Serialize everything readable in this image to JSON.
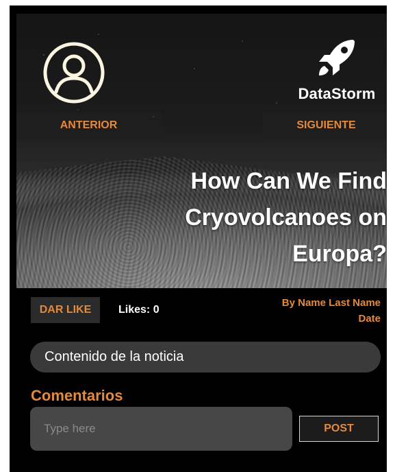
{
  "header": {
    "brand_name": "DataStorm",
    "prev_label": "ANTERIOR",
    "next_label": "SIGUIENTE"
  },
  "article": {
    "title_line1": "How Can We Find",
    "title_line2": "Cryovolcanoes on",
    "title_line3": "Europa?",
    "author": "By Name Last Name",
    "date": "Date",
    "content": "Contenido de la noticia"
  },
  "likes": {
    "button_label": "DAR LIKE",
    "count_text": "Likes: 0"
  },
  "comments": {
    "title": "Comentarios",
    "input_placeholder": "Type here",
    "post_label": "POST"
  },
  "colors": {
    "accent": "#e58a3c",
    "background": "#000000",
    "avatar_stroke": "#fbf4e0"
  },
  "icons": {
    "avatar": "user-circle-icon",
    "brand": "rocket-icon"
  }
}
